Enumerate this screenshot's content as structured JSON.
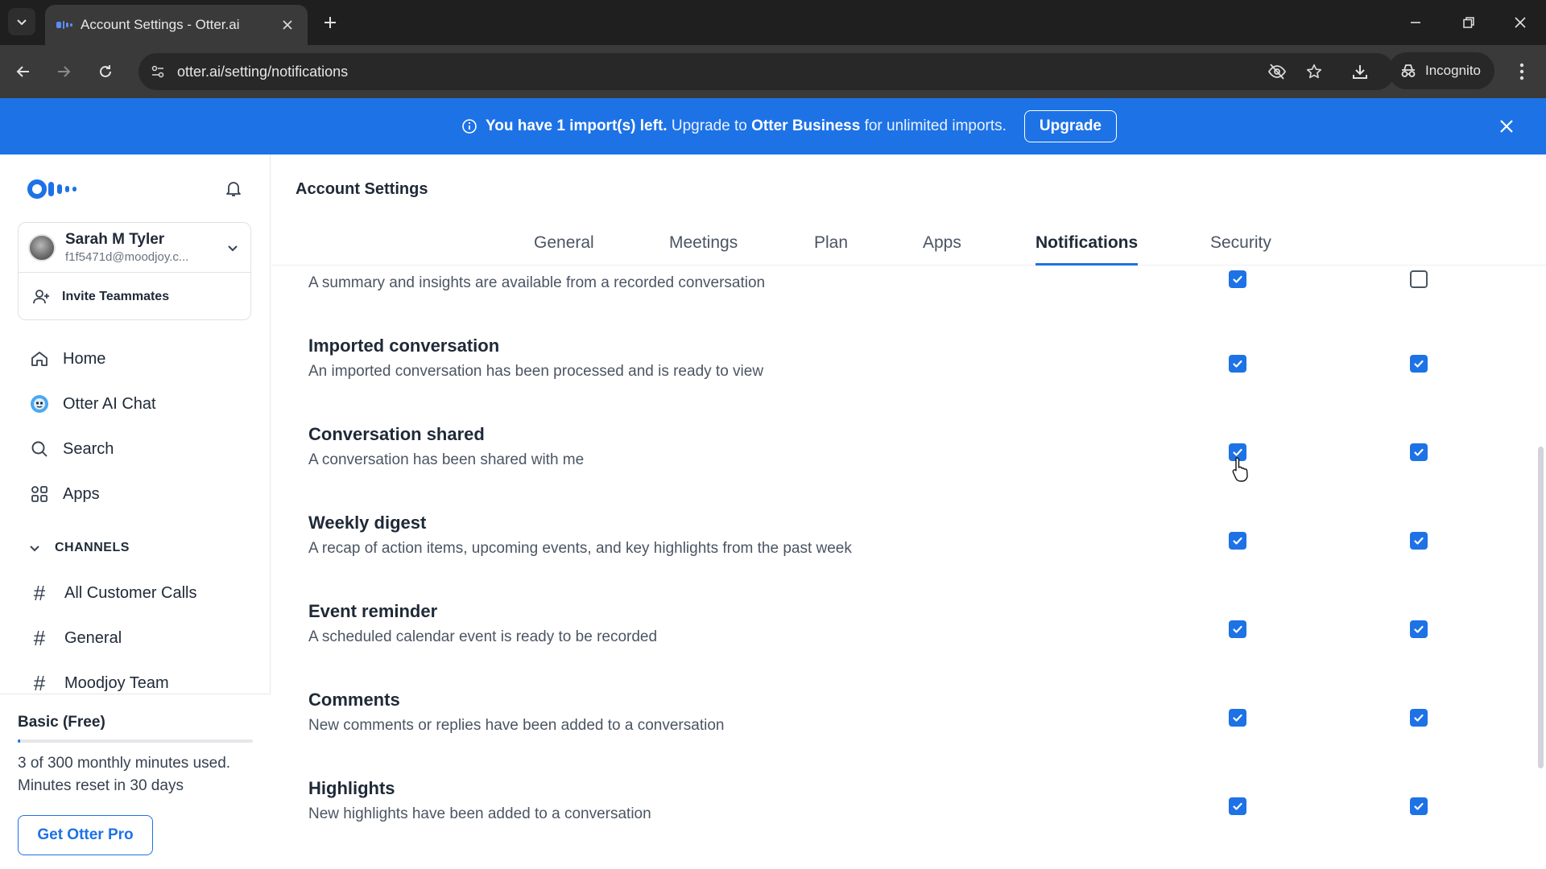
{
  "browser": {
    "tab_title": "Account Settings - Otter.ai",
    "url": "otter.ai/setting/notifications",
    "incognito_label": "Incognito"
  },
  "banner": {
    "message_bold": "You have 1 import(s) left.",
    "message_mid": " Upgrade to ",
    "message_brand": "Otter Business",
    "message_end": " for unlimited imports.",
    "upgrade_label": "Upgrade"
  },
  "sidebar": {
    "user": {
      "name": "Sarah M Tyler",
      "email": "f1f5471d@moodjoy.c..."
    },
    "invite_label": "Invite Teammates",
    "nav": [
      {
        "label": "Home",
        "icon": "home-icon"
      },
      {
        "label": "Otter AI Chat",
        "icon": "otter-ai-chat-icon"
      },
      {
        "label": "Search",
        "icon": "search-icon"
      },
      {
        "label": "Apps",
        "icon": "apps-grid-icon"
      }
    ],
    "channels_header": "CHANNELS",
    "channels": [
      "All Customer Calls",
      "General",
      "Moodjoy Team"
    ],
    "plan": {
      "name": "Basic (Free)",
      "usage_line1": "3 of 300 monthly minutes used.",
      "usage_line2": "Minutes reset in 30 days",
      "usage_fraction": 0.01,
      "cta": "Get Otter Pro"
    }
  },
  "main": {
    "title": "Account Settings",
    "tabs": [
      "General",
      "Meetings",
      "Plan",
      "Apps",
      "Notifications",
      "Security"
    ],
    "active_tab": "Notifications",
    "notifications": [
      {
        "title": "",
        "desc": "A summary and insights are available from a recorded conversation",
        "col1": true,
        "col2": false
      },
      {
        "title": "Imported conversation",
        "desc": "An imported conversation has been processed and is ready to view",
        "col1": true,
        "col2": true
      },
      {
        "title": "Conversation shared",
        "desc": "A conversation has been shared with me",
        "col1": true,
        "col2": true
      },
      {
        "title": "Weekly digest",
        "desc": "A recap of action items, upcoming events, and key highlights from the past week",
        "col1": true,
        "col2": true
      },
      {
        "title": "Event reminder",
        "desc": "A scheduled calendar event is ready to be recorded",
        "col1": true,
        "col2": true
      },
      {
        "title": "Comments",
        "desc": "New comments or replies have been added to a conversation",
        "col1": true,
        "col2": true
      },
      {
        "title": "Highlights",
        "desc": "New highlights have been added to a conversation",
        "col1": true,
        "col2": true
      }
    ]
  },
  "colors": {
    "accent": "#1d72e6",
    "chrome_dark": "#1f1f1f",
    "chrome_toolbar": "#3a3a3a"
  }
}
